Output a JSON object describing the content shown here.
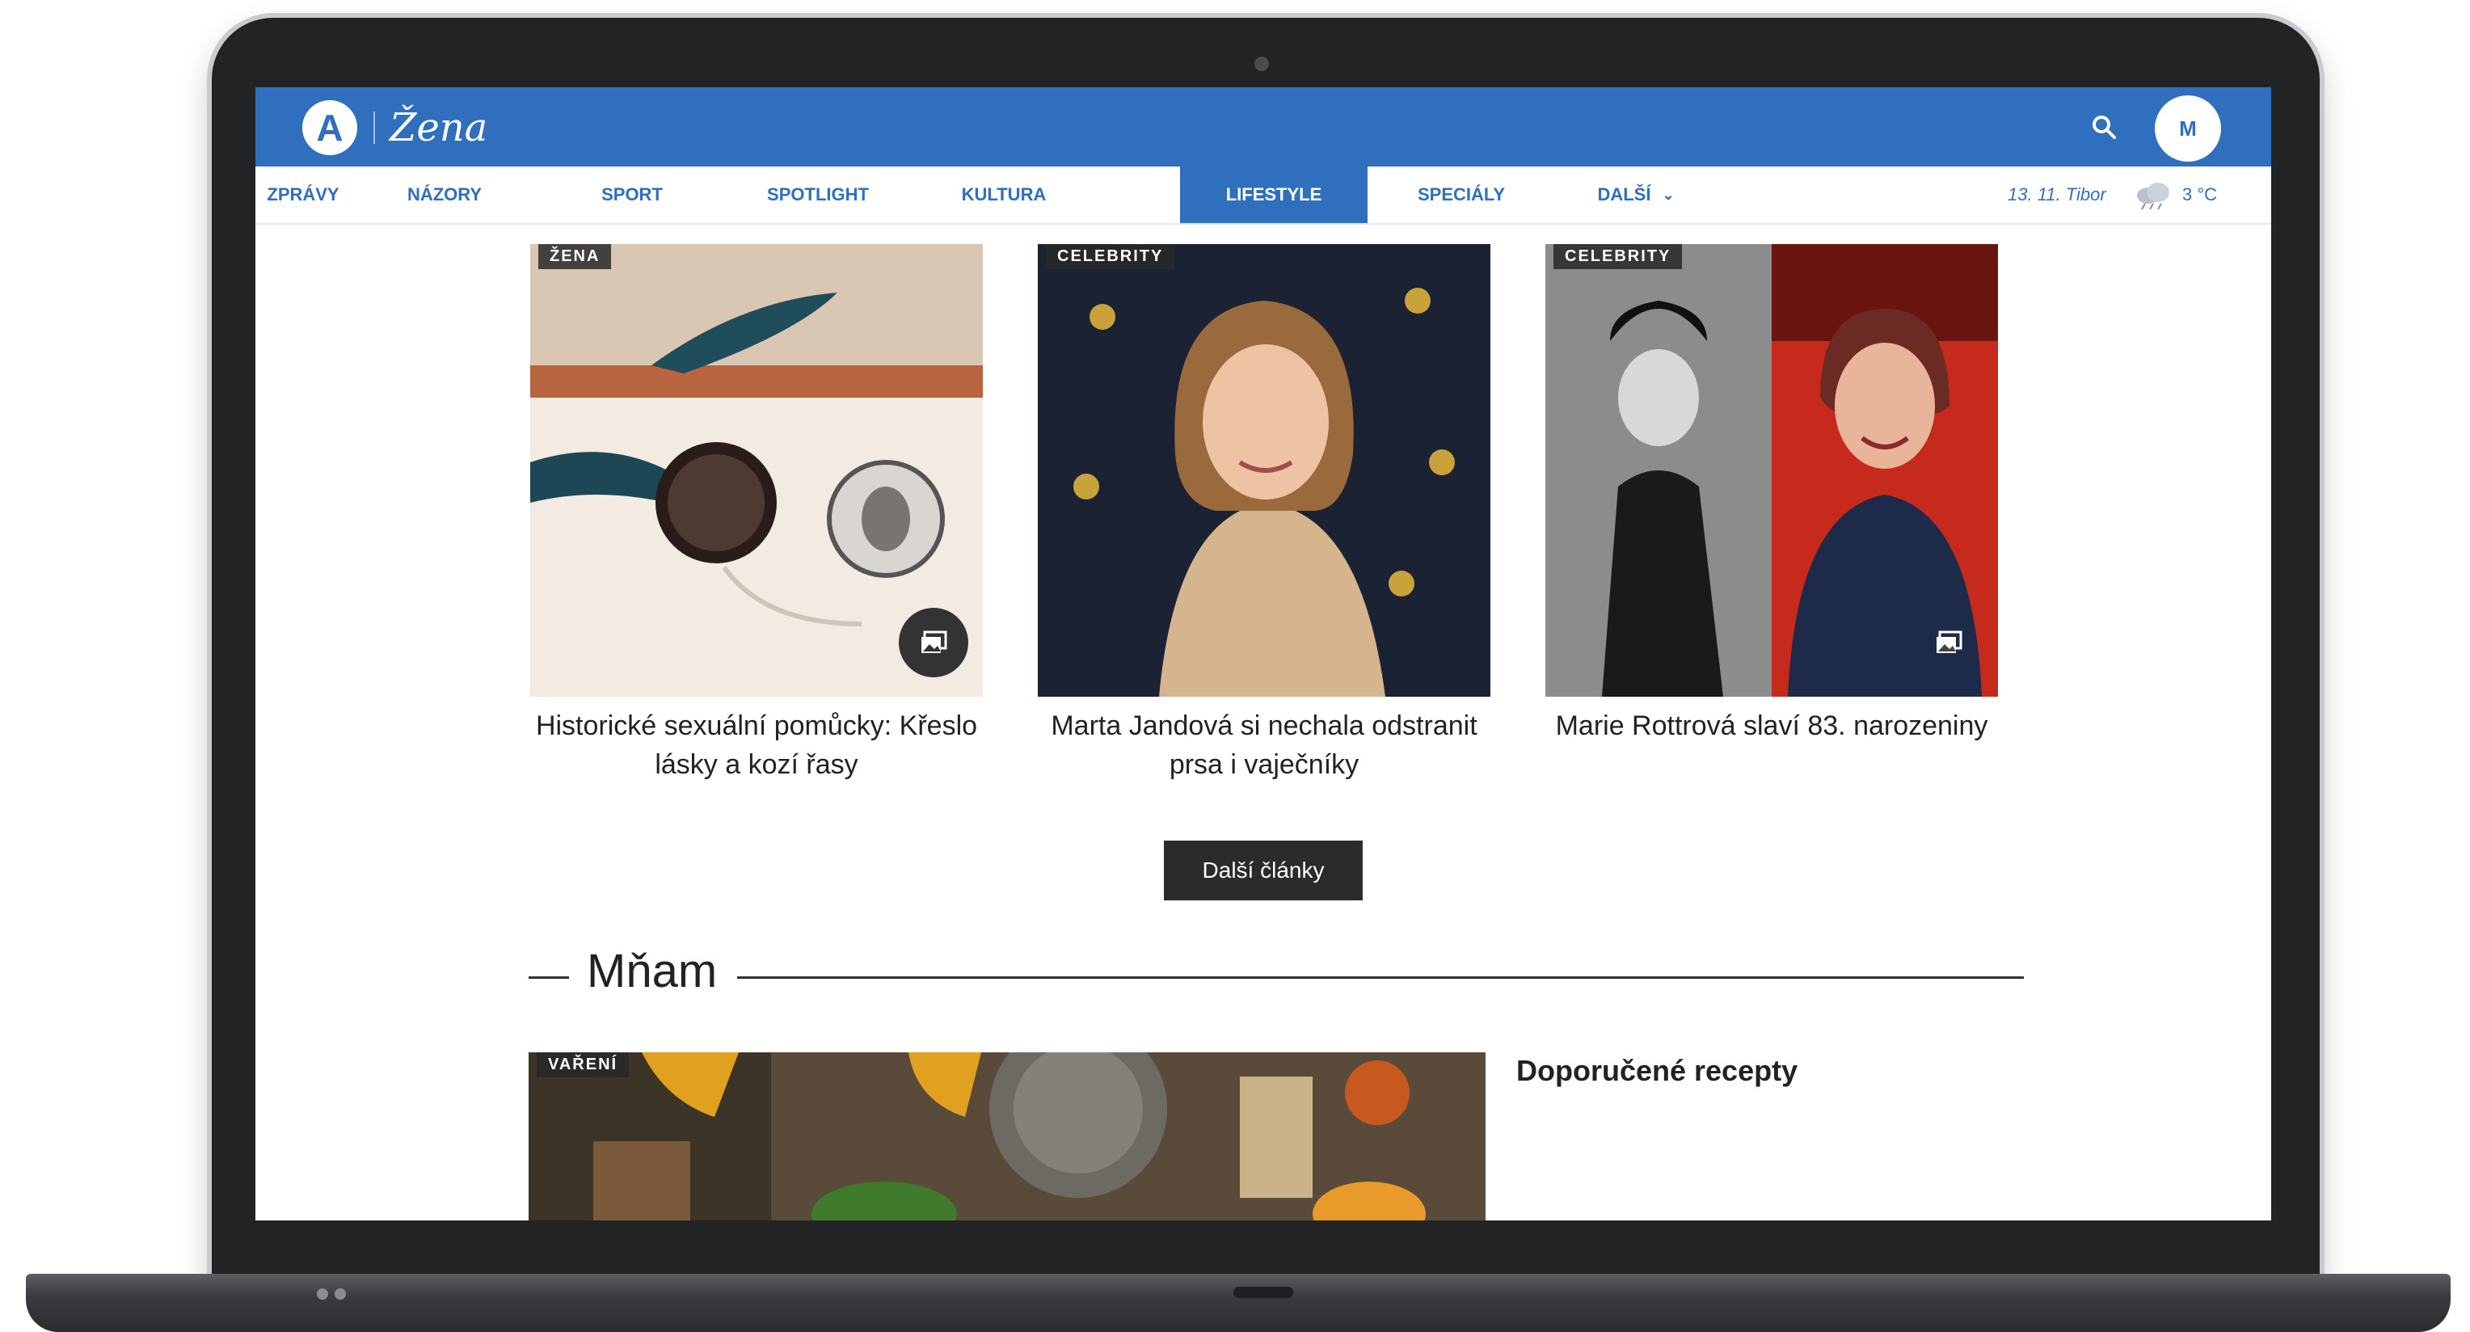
{
  "header": {
    "logo_letter": "A",
    "brand": "Žena",
    "avatar_initial": "M"
  },
  "nav": {
    "items": [
      {
        "label": "ZPRÁVY"
      },
      {
        "label": "NÁZORY"
      },
      {
        "label": "SPORT"
      },
      {
        "label": "SPOTLIGHT"
      },
      {
        "label": "KULTURA"
      },
      {
        "label": "LIFESTYLE",
        "active": true
      },
      {
        "label": "SPECIÁLY"
      },
      {
        "label": "DALŠÍ"
      }
    ],
    "nameday": "13. 11. Tibor",
    "temperature": "3 °C"
  },
  "articles": [
    {
      "badge": "ŽENA",
      "title": "Historické sexuální pomůcky: Křeslo lásky a kozí řasy",
      "image": "photo-antique-glass-objects"
    },
    {
      "badge": "CELEBRITY",
      "title": "Marta Jandová si nechala odstranit prsa i vaječníky",
      "image": "photo-woman-red-carpet"
    },
    {
      "badge": "CELEBRITY",
      "title": "Marie Rottrová slaví 83. narozeniny",
      "image": "photo-singer-collage"
    }
  ],
  "more_button": "Další články",
  "section": {
    "title": "Mňam",
    "hero_badge": "VAŘENÍ",
    "recipes_heading": "Doporučené recepty"
  },
  "colors": {
    "brand_blue": "#2f6fbd",
    "button_dark": "#2b2b2b"
  }
}
